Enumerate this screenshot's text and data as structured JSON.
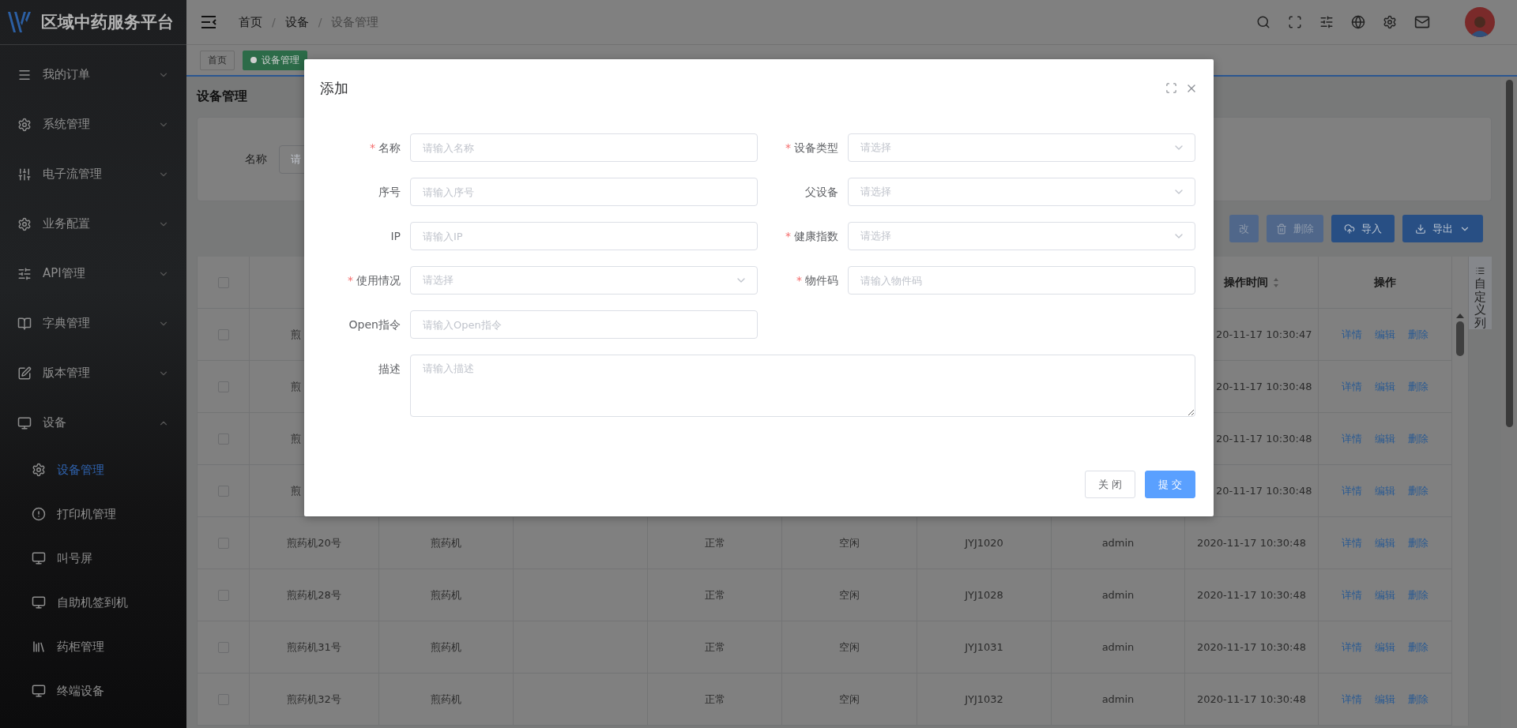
{
  "sidebar": {
    "title": "区域中药服务平台",
    "items": [
      {
        "label": "我的订单",
        "expanded": false
      },
      {
        "label": "系统管理",
        "expanded": false
      },
      {
        "label": "电子流管理",
        "expanded": false
      },
      {
        "label": "业务配置",
        "expanded": false
      },
      {
        "label": "API管理",
        "expanded": false
      },
      {
        "label": "字典管理",
        "expanded": false
      },
      {
        "label": "版本管理",
        "expanded": false
      },
      {
        "label": "设备",
        "expanded": true,
        "children": [
          {
            "label": "设备管理",
            "selected": true
          },
          {
            "label": "打印机管理",
            "selected": false
          },
          {
            "label": "叫号屏",
            "selected": false
          },
          {
            "label": "自助机签到机",
            "selected": false
          },
          {
            "label": "药柜管理",
            "selected": false
          },
          {
            "label": "终端设备",
            "selected": false
          }
        ]
      }
    ]
  },
  "breadcrumb": {
    "separator": "/",
    "items": [
      "首页",
      "设备",
      "设备管理"
    ]
  },
  "tags": [
    {
      "label": "首页",
      "selected": false
    },
    {
      "label": "设备管理",
      "selected": true
    }
  ],
  "page": {
    "title": "设备管理",
    "search": {
      "label": "名称",
      "placeholder": "请"
    },
    "toolbar": [
      {
        "label": "改",
        "kind": "edit",
        "disabled": true
      },
      {
        "label": "删除",
        "kind": "delete",
        "disabled": true
      },
      {
        "label": "导入",
        "kind": "import",
        "disabled": false
      },
      {
        "label": "导出",
        "kind": "export",
        "disabled": false
      }
    ],
    "table": {
      "header_checked": false,
      "headers": [
        {
          "label": "操作时间",
          "sortable": true
        },
        {
          "label": "操作",
          "sortable": false
        }
      ],
      "customize": "自定义列",
      "rows": [
        {
          "kind": "covered",
          "checked": false,
          "name": "煎",
          "time": "20-11-17 10:30:47",
          "actions": [
            "详情",
            "编辑",
            "删除"
          ]
        },
        {
          "kind": "covered",
          "checked": false,
          "name": "煎",
          "time": "20-11-17 10:30:48",
          "actions": [
            "详情",
            "编辑",
            "删除"
          ]
        },
        {
          "kind": "covered",
          "checked": false,
          "name": "煎",
          "time": "20-11-17 10:30:48",
          "actions": [
            "详情",
            "编辑",
            "删除"
          ]
        },
        {
          "kind": "covered",
          "checked": false,
          "name": "煎",
          "time": "20-11-17 10:30:48",
          "actions": [
            "详情",
            "编辑",
            "删除"
          ]
        },
        {
          "kind": "full",
          "checked": false,
          "name": "煎药机20号",
          "type": "煎药机",
          "status": "正常",
          "state": "空闲",
          "code": "JYJ1020",
          "operator": "admin",
          "time": "2020-11-17 10:30:48",
          "actions": [
            "详情",
            "编辑",
            "删除"
          ]
        },
        {
          "kind": "full",
          "checked": false,
          "name": "煎药机28号",
          "type": "煎药机",
          "status": "正常",
          "state": "空闲",
          "code": "JYJ1028",
          "operator": "admin",
          "time": "2020-11-17 10:30:48",
          "actions": [
            "详情",
            "编辑",
            "删除"
          ]
        },
        {
          "kind": "full",
          "checked": false,
          "name": "煎药机31号",
          "type": "煎药机",
          "status": "正常",
          "state": "空闲",
          "code": "JYJ1031",
          "operator": "admin",
          "time": "2020-11-17 10:30:48",
          "actions": [
            "详情",
            "编辑",
            "删除"
          ]
        },
        {
          "kind": "full",
          "checked": false,
          "name": "煎药机32号",
          "type": "煎药机",
          "status": "正常",
          "state": "空闲",
          "code": "JYJ1032",
          "operator": "admin",
          "time": "2020-11-17 10:30:48",
          "actions": [
            "详情",
            "编辑",
            "删除"
          ]
        }
      ]
    }
  },
  "modal": {
    "title": "添加",
    "required_mark": "*",
    "fields": [
      {
        "label": "名称",
        "required": true,
        "kind": "input",
        "placeholder": "请输入名称"
      },
      {
        "label": "设备类型",
        "required": true,
        "kind": "select",
        "placeholder": "请选择"
      },
      {
        "label": "序号",
        "required": false,
        "kind": "input",
        "placeholder": "请输入序号"
      },
      {
        "label": "父设备",
        "required": false,
        "kind": "select",
        "placeholder": "请选择"
      },
      {
        "label": "IP",
        "required": false,
        "kind": "input",
        "placeholder": "请输入IP"
      },
      {
        "label": "健康指数",
        "required": true,
        "kind": "select",
        "placeholder": "请选择"
      },
      {
        "label": "使用情况",
        "required": true,
        "kind": "select",
        "placeholder": "请选择"
      },
      {
        "label": "物件码",
        "required": true,
        "kind": "input",
        "placeholder": "请输入物件码"
      },
      {
        "label": "Open指令",
        "required": false,
        "kind": "input",
        "placeholder": "请输入Open指令"
      },
      {
        "label": "描述",
        "required": false,
        "kind": "textarea",
        "placeholder": "请输入描述"
      }
    ],
    "buttons": [
      {
        "label": "关 闭",
        "kind": "secondary"
      },
      {
        "label": "提 交",
        "kind": "primary"
      }
    ]
  }
}
